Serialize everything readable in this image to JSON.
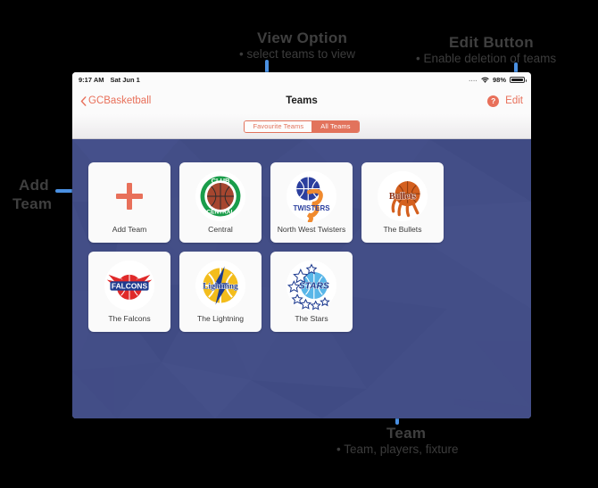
{
  "annotations": [
    {
      "id": "add-team",
      "title": "Add\nTeam",
      "title_lines": [
        "Add",
        "Team"
      ],
      "subtitle": ""
    },
    {
      "id": "view-option",
      "title": "View Option",
      "subtitle": "• select teams to view"
    },
    {
      "id": "edit-button",
      "title": "Edit Button",
      "subtitle": "• Enable deletion of teams"
    },
    {
      "id": "team",
      "title": "Team",
      "subtitle": "• Team, players, fixture"
    }
  ],
  "anno": {
    "add_team_line1": "Add",
    "add_team_line2": "Team",
    "view_option_title": "View Option",
    "view_option_sub": "• select teams to view",
    "edit_button_title": "Edit Button",
    "edit_button_sub": "• Enable deletion of teams",
    "team_title": "Team",
    "team_sub": "• Team, players, fixture"
  },
  "device": {
    "statusbar": {
      "time": "9:17 AM",
      "date": "Sat Jun 1",
      "signal_dots": "....",
      "wifi_icon": "wifi-icon",
      "battery_percent": "98%",
      "battery_icon": "battery-icon",
      "battery_level": 98
    },
    "navbar": {
      "back_icon": "chevron-left-icon",
      "back_label": "GCBasketball",
      "title": "Teams",
      "help_badge": "?",
      "edit_label": "Edit"
    },
    "segmented_control": {
      "options": [
        {
          "label": "Favourite Teams",
          "active": false
        },
        {
          "label": "All Teams",
          "active": true
        }
      ]
    },
    "teams_grid": {
      "cards": [
        {
          "name": "Add Team",
          "type": "add",
          "icon": "plus-icon"
        },
        {
          "name": "Central",
          "type": "team",
          "icon": "club-central-logo"
        },
        {
          "name": "North West Twisters",
          "type": "team",
          "icon": "twisters-logo"
        },
        {
          "name": "The Bullets",
          "type": "team",
          "icon": "bullets-logo"
        },
        {
          "name": "The Falcons",
          "type": "team",
          "icon": "falcons-logo"
        },
        {
          "name": "The Lightning",
          "type": "team",
          "icon": "lightning-logo"
        },
        {
          "name": "The Stars",
          "type": "team",
          "icon": "stars-logo"
        }
      ]
    }
  },
  "colors": {
    "accent": "#e8705a",
    "content_bg": "#434e87",
    "annotation_line": "#4a90e2",
    "annotation_text": "#3f3f3f",
    "page_bg": "#000000"
  }
}
